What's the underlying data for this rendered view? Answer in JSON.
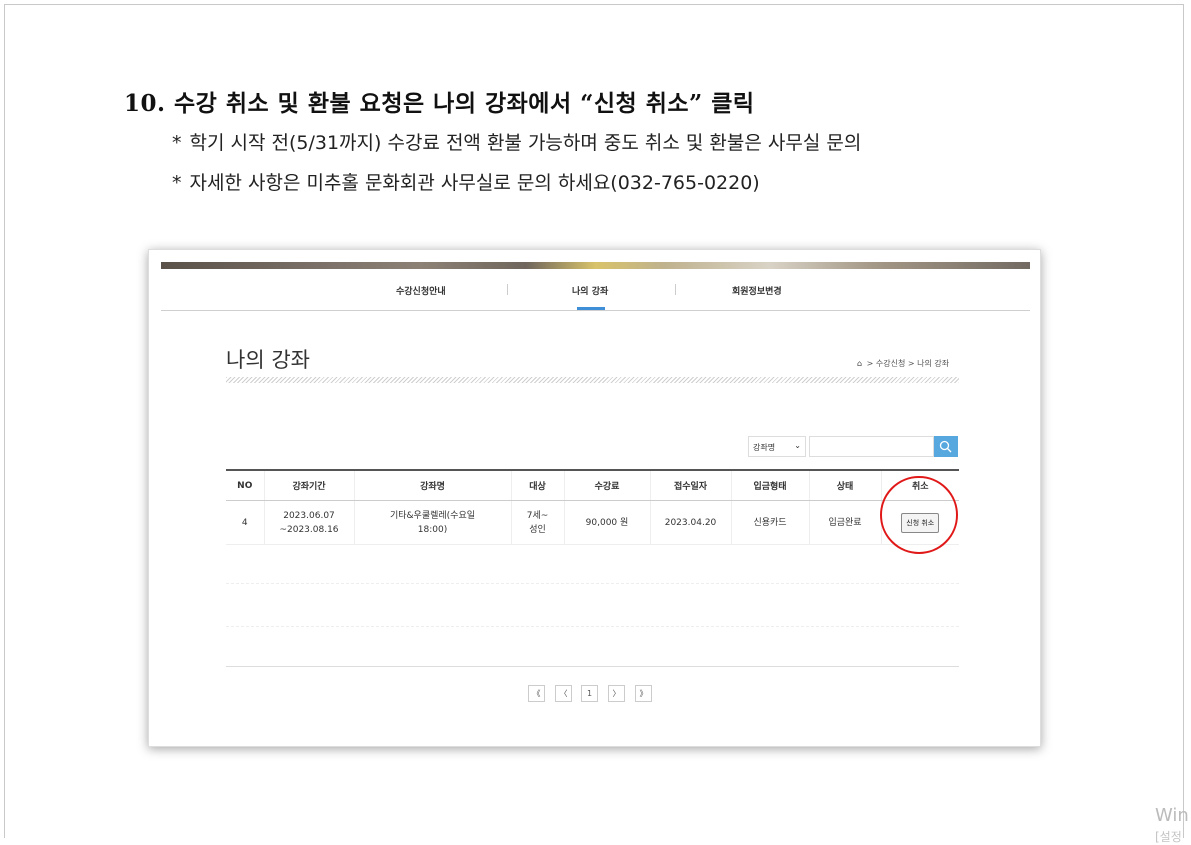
{
  "document": {
    "title": "10. 수강 취소 및 환불 요청은 나의 강좌에서 “신청 취소” 클릭",
    "notes": [
      {
        "bullet": "*",
        "text": "학기 시작 전(5/31까지) 수강료 전액 환불 가능하며 중도 취소 및 환불은 사무실 문의"
      },
      {
        "bullet": "*",
        "text": "자세한 사항은 미추홀 문화회관 사무실로 문의 하세요(032-765-0220)"
      }
    ]
  },
  "screenshot": {
    "nav": {
      "items": [
        {
          "label": "수강신청안내"
        },
        {
          "label": "나의 강좌"
        },
        {
          "label": "회원정보변경"
        }
      ],
      "active": "나의 강좌"
    },
    "page_title": "나의 강좌",
    "breadcrumb": {
      "home_icon": "home-icon",
      "items": [
        "수강신청",
        "나의 강좌"
      ],
      "separator": ">"
    },
    "search": {
      "select_value": "강좌명",
      "input_value": "",
      "button_icon": "search-icon"
    },
    "table": {
      "headers": [
        "NO",
        "강좌기간",
        "강좌명",
        "대상",
        "수강료",
        "접수일자",
        "입금형태",
        "상태",
        "취소"
      ],
      "rows": [
        {
          "no": "4",
          "period_start": "2023.06.07",
          "period_end": "~2023.08.16",
          "name_line1": "기타&우쿨렐레(수요일",
          "name_line2": "18:00)",
          "target_line1": "7세~",
          "target_line2": "성인",
          "fee": "90,000 원",
          "date": "2023.04.20",
          "payment": "신용카드",
          "status": "입금완료",
          "cancel_label": "신청 취소"
        }
      ]
    },
    "pager": {
      "first": "《",
      "prev": "〈",
      "current": "1",
      "next": "〉",
      "last": "》"
    },
    "highlight_color": "#e01818"
  },
  "os_watermark": {
    "line1": "Win",
    "line2": "[설정"
  }
}
